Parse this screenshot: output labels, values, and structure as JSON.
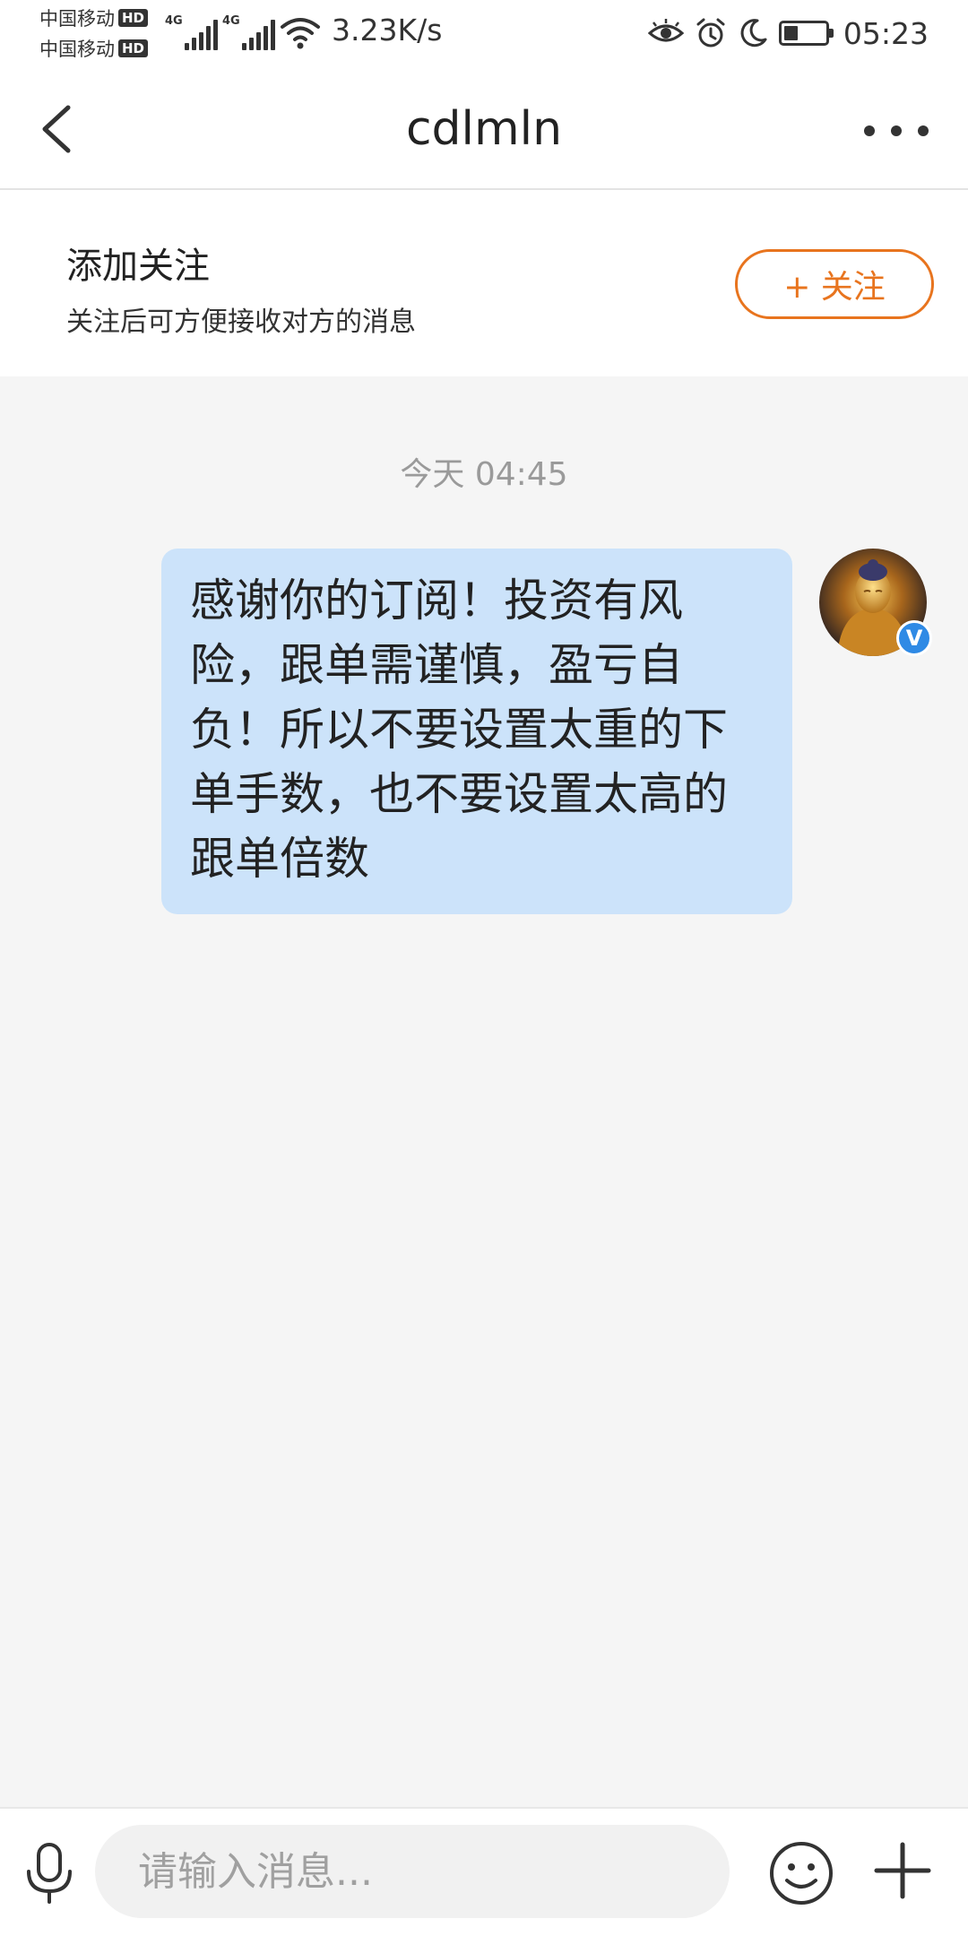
{
  "status_bar": {
    "carriers": [
      {
        "name": "中国移动",
        "badge": "HD"
      },
      {
        "name": "中国移动",
        "badge": "HD"
      }
    ],
    "signal_tags": [
      "4G",
      "4G"
    ],
    "network_speed": "3.23K/s",
    "time": "05:23",
    "battery_level": 0.35,
    "icons": [
      "eye-icon",
      "alarm-icon",
      "moon-icon",
      "battery-icon"
    ]
  },
  "header": {
    "title": "cdlmln",
    "back_icon": "chevron-left-icon",
    "more_icon": "more-dots-icon"
  },
  "follow_banner": {
    "title": "添加关注",
    "description": "关注后可方便接收对方的消息",
    "button_label": "+ 关注",
    "accent_color": "#e8741e"
  },
  "chat": {
    "timestamp": "今天 04:45",
    "messages": [
      {
        "text": "感谢你的订阅！投资有风险，跟单需谨慎，盈亏自负！所以不要设置太重的下单手数，也不要设置太高的跟单倍数",
        "bubble_color": "#cce3fa",
        "verified_badge": "V"
      }
    ]
  },
  "input_bar": {
    "placeholder": "请输入消息...",
    "value": "",
    "icons": [
      "microphone-icon",
      "emoji-icon",
      "plus-icon"
    ]
  }
}
